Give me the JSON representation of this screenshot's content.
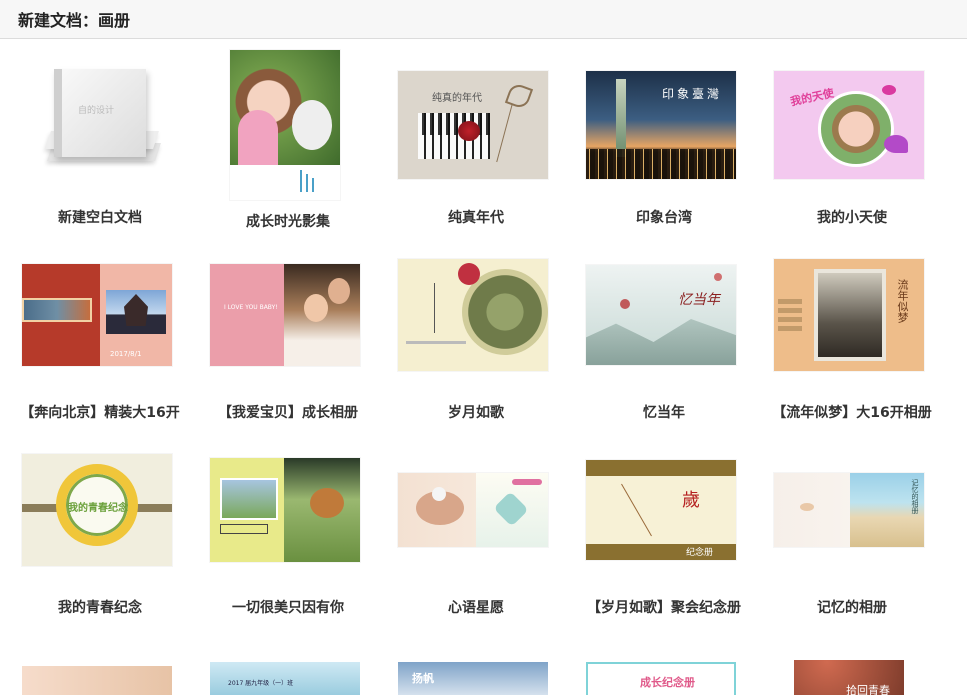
{
  "header": {
    "title": "新建文档：画册"
  },
  "albums": [
    {
      "label": "新建空白文档",
      "cover_text": "自的设计",
      "style": "blank"
    },
    {
      "label": "成长时光影集",
      "style": "portrait"
    },
    {
      "label": "纯真年代",
      "cover_text": "纯真的年代",
      "style": "piano"
    },
    {
      "label": "印象台湾",
      "cover_text": "印象臺灣",
      "style": "city"
    },
    {
      "label": "我的小天使",
      "cover_text": "我的天使",
      "style": "angel"
    },
    {
      "label": "【奔向北京】精装大16开",
      "cover_text": "2017/8/1",
      "style": "beijing"
    },
    {
      "label": "【我爱宝贝】成长相册",
      "cover_text": "I LOVE YOU BABY!",
      "style": "baby"
    },
    {
      "label": "岁月如歌",
      "style": "lotus"
    },
    {
      "label": "忆当年",
      "cover_text": "忆当年",
      "style": "ink"
    },
    {
      "label": "【流年似梦】大16开相册",
      "cover_text": "流年似梦",
      "style": "oldphoto"
    },
    {
      "label": "我的青春纪念",
      "cover_text": "我的青春纪念",
      "style": "wreath"
    },
    {
      "label": "一切很美只因有你",
      "style": "guitar"
    },
    {
      "label": "心语星愿",
      "style": "wish"
    },
    {
      "label": "【岁月如歌】聚会纪念册",
      "cover_text": "纪念册",
      "style": "party"
    },
    {
      "label": "记忆的相册",
      "cover_text": "记忆的相册",
      "style": "beach"
    }
  ],
  "partial_row": [
    {
      "style": "peek1"
    },
    {
      "style": "peek2",
      "cover_text": "2017 届九年级（一）班"
    },
    {
      "style": "peek3",
      "cover_text": "扬帆"
    },
    {
      "style": "peek4",
      "cover_text": "成长纪念册"
    },
    {
      "style": "peek5",
      "cover_text": "拾回青春"
    }
  ]
}
